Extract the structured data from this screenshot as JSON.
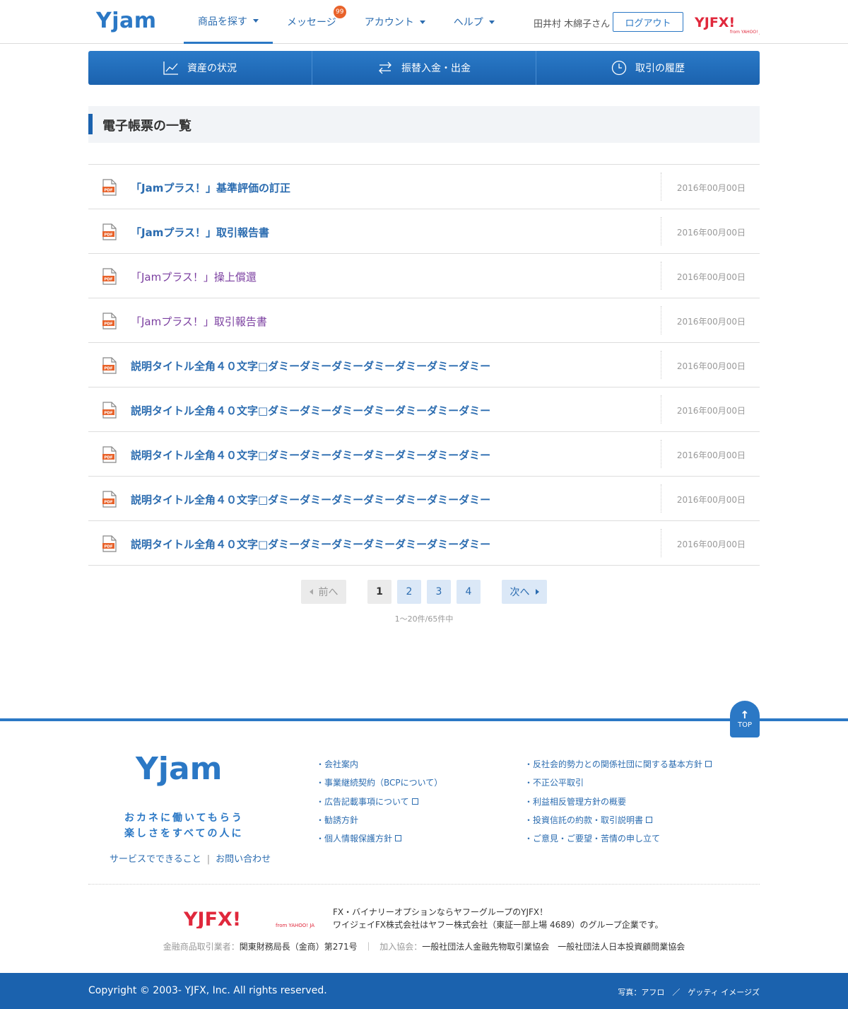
{
  "header": {
    "logo": "Yjam",
    "nav": [
      {
        "label": "商品を探す",
        "active": true
      },
      {
        "label": "メッセージ",
        "badge": "99"
      },
      {
        "label": "アカウント"
      },
      {
        "label": "ヘルプ"
      }
    ],
    "user_name": "田井村 木綿子さん",
    "logout_label": "ログアウト",
    "brand_logo": "YJFX!",
    "brand_logo_sub": "from YAHOO! JAPAN"
  },
  "tabs": [
    {
      "label": "資産の状況",
      "icon": "chart-line-icon"
    },
    {
      "label": "振替入金・出金",
      "icon": "transfer-arrows-icon"
    },
    {
      "label": "取引の履歴",
      "icon": "clock-icon"
    }
  ],
  "page_title": "電子帳票の一覧",
  "documents": [
    {
      "title": "「Jamプラス！」基準評価の訂正",
      "date": "2016年00月00日",
      "visited": false
    },
    {
      "title": "「Jamプラス！」取引報告書",
      "date": "2016年00月00日",
      "visited": false
    },
    {
      "title": "「Jamプラス！」操上償還",
      "date": "2016年00月00日",
      "visited": true
    },
    {
      "title": "「Jamプラス！」取引報告書",
      "date": "2016年00月00日",
      "visited": true
    },
    {
      "title": "説明タイトル全角４０文字□ダミーダミーダミーダミーダミーダミーダミー",
      "date": "2016年00月00日",
      "visited": false
    },
    {
      "title": "説明タイトル全角４０文字□ダミーダミーダミーダミーダミーダミーダミー",
      "date": "2016年00月00日",
      "visited": false
    },
    {
      "title": "説明タイトル全角４０文字□ダミーダミーダミーダミーダミーダミーダミー",
      "date": "2016年00月00日",
      "visited": false
    },
    {
      "title": "説明タイトル全角４０文字□ダミーダミーダミーダミーダミーダミーダミー",
      "date": "2016年00月00日",
      "visited": false
    },
    {
      "title": "説明タイトル全角４０文字□ダミーダミーダミーダミーダミーダミーダミー",
      "date": "2016年00月00日",
      "visited": false
    }
  ],
  "pager": {
    "prev_label": "前へ",
    "next_label": "次へ",
    "pages": [
      "1",
      "2",
      "3",
      "4"
    ],
    "current_page": "1",
    "count_text": "1〜20件/65件中"
  },
  "footer": {
    "top_label": "TOP",
    "logo": "Yjam",
    "tagline_1": "おカネに働いてもらう",
    "tagline_2": "楽しさをすべての人に",
    "link_service": "サービスでできること",
    "link_contact": "お問い合わせ",
    "col1": [
      {
        "label": "・会社案内",
        "external": false
      },
      {
        "label": "・事業継続契約（BCPについて）",
        "external": false
      },
      {
        "label": "・広告記載事項について",
        "external": true
      },
      {
        "label": "・勧誘方針",
        "external": false
      },
      {
        "label": "・個人情報保護方針",
        "external": true
      }
    ],
    "col2": [
      {
        "label": "・反社会的勢力との関係社団に関する基本方針",
        "external": true
      },
      {
        "label": "・不正公平取引",
        "external": false
      },
      {
        "label": "・利益相反管理方針の概要",
        "external": false
      },
      {
        "label": "・投資信託の約款・取引説明書",
        "external": true
      },
      {
        "label": "・ご意見・ご要望・苦情の申し立て",
        "external": false
      }
    ],
    "desc_1": "FX・バイナリーオプションならヤフーグループのYJFX！",
    "desc_2": "ワイジェイFX株式会社はヤフー株式会社（東証一部上場 4689）のグループ企業です。",
    "reg_label_1": "金融商品取引業者：",
    "reg_value_1": "関東財務局長（金商）第271号",
    "reg_sep": "｜",
    "reg_label_2": "加入協会：",
    "reg_value_2": "一般社団法人金融先物取引業協会　一般社団法人日本投資顧問業協会",
    "copyright": "Copyright © 2003- YJFX, Inc. All rights reserved.",
    "photo_credit": "写真：アフロ　／　ゲッティ イメージズ"
  },
  "colors": {
    "primary": "#2b78c5",
    "primary_dark": "#1b62ae",
    "link": "#2b6cb0",
    "visited": "#7b3fa0",
    "badge": "#e8622a",
    "brand_red": "#e0283c"
  }
}
